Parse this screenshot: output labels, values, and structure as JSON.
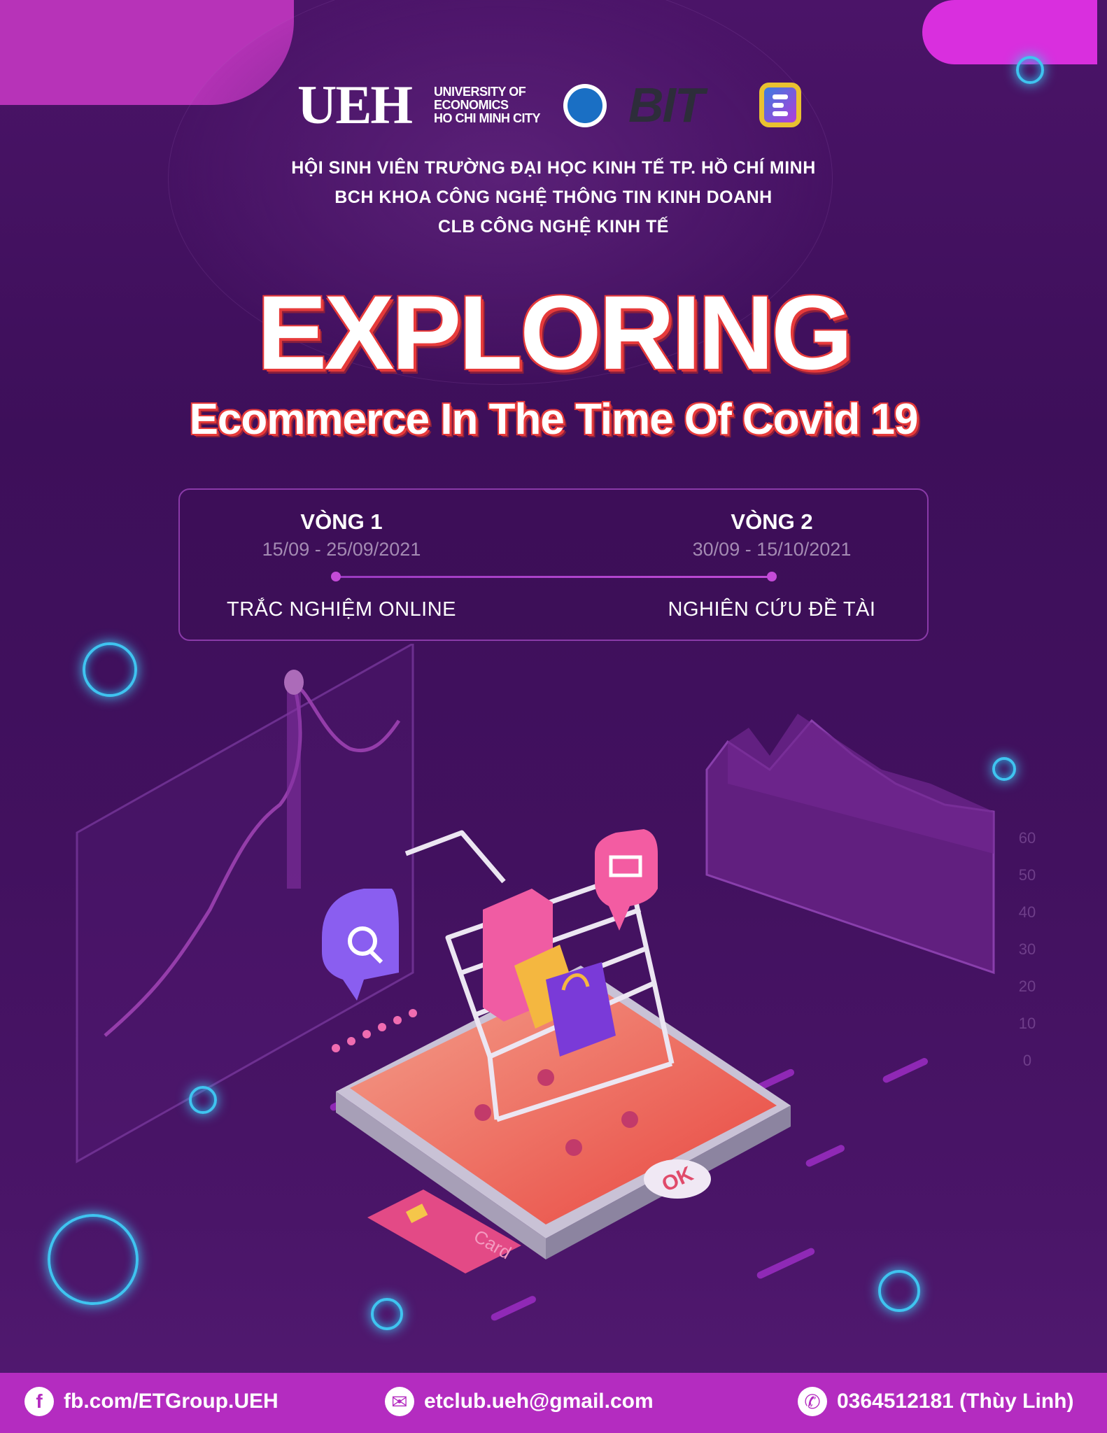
{
  "header": {
    "ueh_mark": "UEH",
    "ueh_sub_1": "UNIVERSITY OF",
    "ueh_sub_2": "ECONOMICS",
    "ueh_sub_3": "HO CHI MINH CITY",
    "bit_logo": "BIT",
    "org_lines": [
      "HỘI SINH VIÊN TRƯỜNG ĐẠI HỌC KINH TẾ TP. HỒ CHÍ MINH",
      "BCH KHOA CÔNG NGHỆ THÔNG TIN KINH DOANH",
      "CLB CÔNG NGHỆ KINH TẾ"
    ]
  },
  "title": {
    "main": "EXPLORING",
    "sub": "Ecommerce In The Time Of Covid 19"
  },
  "rounds": [
    {
      "name": "VÒNG 1",
      "date": "15/09 - 25/09/2021",
      "desc": "TRẮC NGHIỆM ONLINE"
    },
    {
      "name": "VÒNG 2",
      "date": "30/09 - 15/10/2021",
      "desc": "NGHIÊN CỨU ĐỀ TÀI"
    }
  ],
  "illustration": {
    "ok_button": "OK",
    "card_label": "Card",
    "chart_ticks": [
      "60",
      "50",
      "40",
      "30",
      "20",
      "10",
      "0"
    ]
  },
  "footer": {
    "facebook": "fb.com/ETGroup.UEH",
    "email": "etclub.ueh@gmail.com",
    "phone": "0364512181 (Thùy Linh)",
    "facebook_icon": "f",
    "email_icon": "✉",
    "phone_icon": "✆"
  },
  "colors": {
    "background": "#42115f",
    "accent_magenta": "#b42cc0",
    "title_outline": "#e63a3a",
    "virus_glow": "#3fc4f0"
  }
}
